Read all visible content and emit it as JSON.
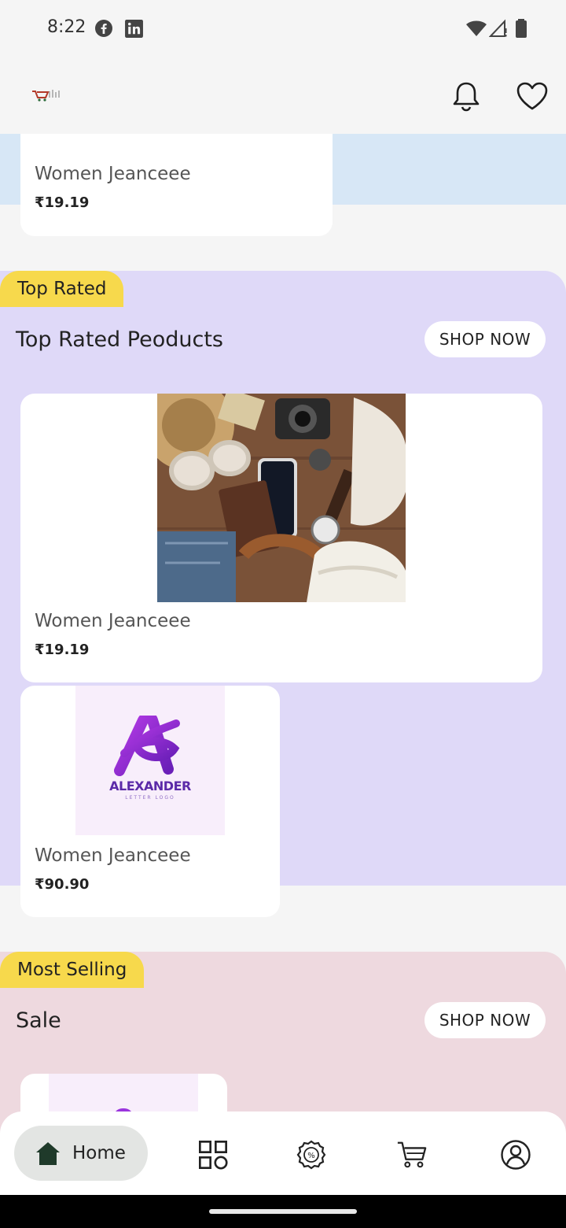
{
  "status_bar": {
    "time": "8:22"
  },
  "header": {
    "icons": [
      "notification-bell-icon",
      "wishlist-heart-icon"
    ]
  },
  "top_partial_card": {
    "name": "Women Jeanceee",
    "price": "₹19.19"
  },
  "top_rated": {
    "badge": "Top Rated",
    "title": "Top Rated Peoducts",
    "shop_now": "SHOP NOW",
    "background": "#dfd9f8",
    "products": [
      {
        "name": "Women Jeanceee",
        "price": "₹19.19"
      },
      {
        "name": "Women Jeanceee",
        "price": "₹90.90",
        "logo_text": "ALEXANDER",
        "logo_subtext": "LETTER LOGO"
      }
    ]
  },
  "most_selling": {
    "badge": "Most Selling",
    "title": "Sale",
    "shop_now": "SHOP NOW",
    "background": "#eed9df"
  },
  "bottom_nav": {
    "home_label": "Home",
    "items": [
      "home-icon",
      "categories-icon",
      "offers-icon",
      "cart-icon",
      "profile-icon"
    ]
  },
  "colors": {
    "badge": "#f7d94c",
    "top_banner": "#d7e7f6",
    "accent_purple": "#8e2fd6"
  }
}
